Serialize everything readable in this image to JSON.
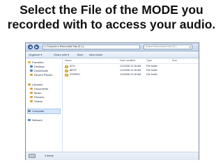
{
  "slide": {
    "title_line1": "Select the File of the MODE you",
    "title_line2": "recorded with to access your audio."
  },
  "explorer": {
    "address": "▸ Computer ▸ Removable Disk (E:) ▸",
    "search_placeholder": "Search Removable Disk (E:)",
    "toolbar": [
      "Organize ▾",
      "Share with ▾",
      "Burn",
      "New folder"
    ],
    "nav": [
      {
        "label": "Favorites",
        "icon": "star-icon",
        "color": "#e8b83a"
      },
      {
        "label": "Desktop",
        "icon": "desktop-icon",
        "color": "#4a7fc1"
      },
      {
        "label": "Downloads",
        "icon": "downloads-icon",
        "color": "#4a7fc1"
      },
      {
        "label": "Recent Places",
        "icon": "recent-places-icon",
        "color": "#d9a441"
      },
      {
        "label": "Libraries",
        "icon": "library-icon",
        "color": "#d9a441"
      },
      {
        "label": "Documents",
        "icon": "documents-icon",
        "color": "#d9a441"
      },
      {
        "label": "Music",
        "icon": "music-icon",
        "color": "#d9a441"
      },
      {
        "label": "Pictures",
        "icon": "pictures-icon",
        "color": "#d9a441"
      },
      {
        "label": "Videos",
        "icon": "videos-icon",
        "color": "#d9a441"
      },
      {
        "label": "Computer",
        "icon": "computer-icon",
        "color": "#6a86a8"
      },
      {
        "label": "Network",
        "icon": "network-icon",
        "color": "#4a7fc1"
      }
    ],
    "columns": [
      "Name",
      "Date modified",
      "Type",
      "Size"
    ],
    "rows": [
      {
        "name": "ACH",
        "date": "1/1/2008 12:16 AM",
        "type": "File folder"
      },
      {
        "name": "BETR",
        "date": "1/1/2008 12:16 AM",
        "type": "File folder"
      },
      {
        "name": "STEREO",
        "date": "1/1/2008 12:16 AM",
        "type": "File folder"
      }
    ],
    "status": "3 items",
    "colors": {
      "folder": "#e8c456",
      "selection": "#d6e6fa"
    }
  }
}
